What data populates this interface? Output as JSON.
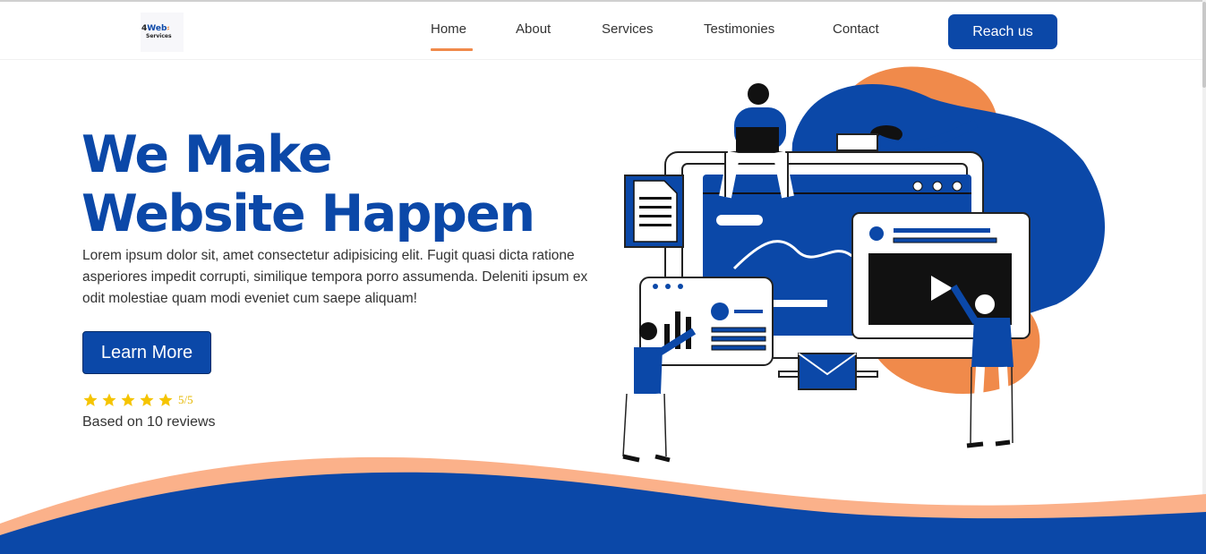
{
  "colors": {
    "brand_blue": "#0b48a8",
    "accent_orange": "#f08a4b",
    "star_yellow": "#f5c400",
    "wave_peach": "#fbb18a"
  },
  "logo": {
    "line1_prefix": "4",
    "line1_word": "Web",
    "line2": "Services"
  },
  "nav": {
    "items": [
      "Home",
      "About",
      "Services",
      "Testimonies",
      "Contact"
    ],
    "active": "Home",
    "cta_label": "Reach us"
  },
  "hero": {
    "title_line1": "We Make",
    "title_line2": "Website Happen",
    "description": "Lorem ipsum dolor sit, amet consectetur adipisicing elit. Fugit quasi dicta ratione asperiores impedit corrupti, similique tempora porro assumenda. Deleniti ipsum ex odit molestiae quam modi eveniet cum saepe aliquam!",
    "button_label": "Learn More",
    "rating": {
      "stars": 5,
      "max": 5,
      "score_text": "5/5",
      "reviews_text": "Based on 10 reviews"
    }
  },
  "illustration": {
    "icon": "web-development-illustration"
  }
}
